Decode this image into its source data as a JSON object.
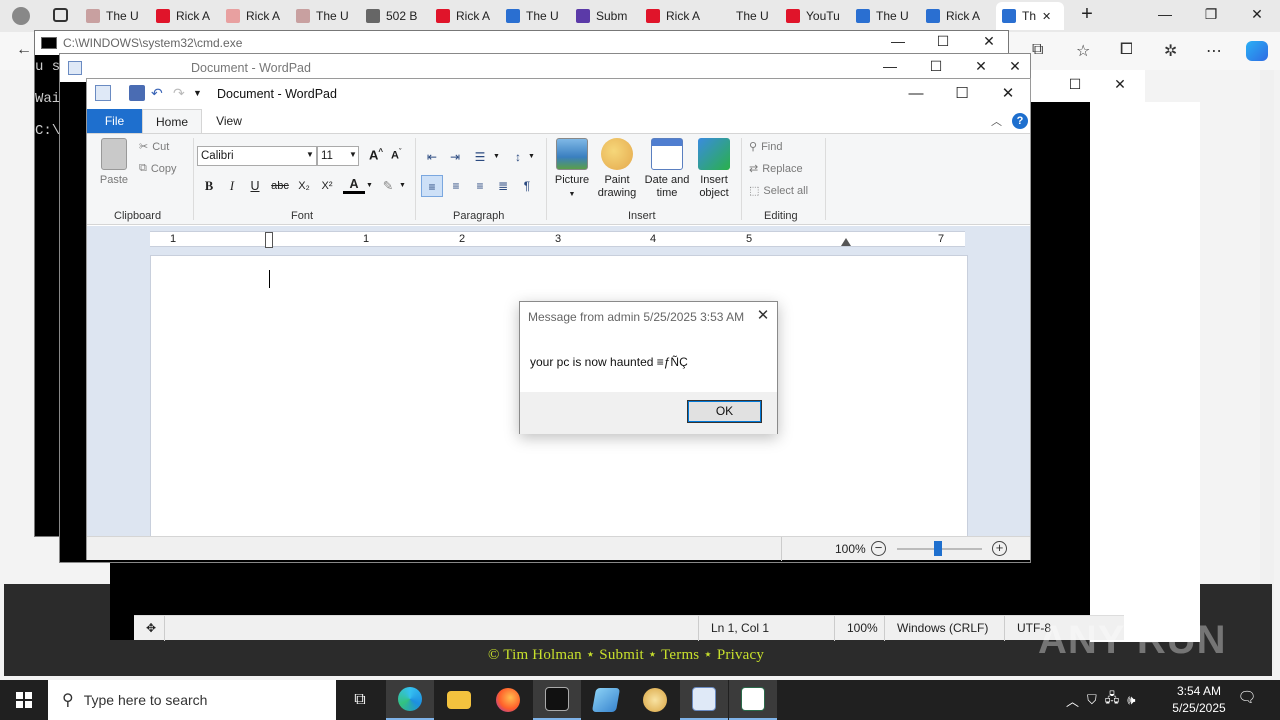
{
  "browser": {
    "tabs": [
      {
        "label": "The U",
        "color": "#c8a0a0"
      },
      {
        "label": "Rick A",
        "color": "#e0142a"
      },
      {
        "label": "Rick A",
        "color": "#e8a0a0"
      },
      {
        "label": "The U",
        "color": "#c8a0a0"
      },
      {
        "label": "502 B",
        "color": "#666666"
      },
      {
        "label": "Rick A",
        "color": "#e0142a"
      },
      {
        "label": "The U",
        "color": "#2a6fd1"
      },
      {
        "label": "Subm",
        "color": "#5b3aa8"
      },
      {
        "label": "Rick A",
        "color": "#e0142a"
      },
      {
        "label": "The U",
        "color": "#e9e9e9"
      },
      {
        "label": "YouTu",
        "color": "#e0142a"
      },
      {
        "label": "The U",
        "color": "#2a6fd1"
      },
      {
        "label": "Rick A",
        "color": "#2a6fd1"
      },
      {
        "label": "Th",
        "color": "#2a6fd1"
      }
    ],
    "footer_links": "© Tim Holman ⋆ Submit ⋆ Terms ⋆ Privacy"
  },
  "cmd": {
    "title": "C:\\WINDOWS\\system32\\cmd.exe",
    "lines": [
      "u s",
      "Wai",
      "C:\\"
    ]
  },
  "wordpad_back": {
    "title": "Document - WordPad"
  },
  "wordpad": {
    "title": "Document - WordPad",
    "tabs": {
      "file": "File",
      "home": "Home",
      "view": "View"
    },
    "clipboard": {
      "paste": "Paste",
      "cut": "Cut",
      "copy": "Copy",
      "label": "Clipboard"
    },
    "font": {
      "family": "Calibri",
      "size": "11",
      "label": "Font"
    },
    "paragraph": {
      "label": "Paragraph"
    },
    "insert": {
      "picture": "Picture",
      "paint_1": "Paint",
      "paint_2": "drawing",
      "datetime_1": "Date and",
      "datetime_2": "time",
      "object_1": "Insert",
      "object_2": "object",
      "label": "Insert"
    },
    "editing": {
      "find": "Find",
      "replace": "Replace",
      "select_all": "Select all",
      "label": "Editing"
    },
    "ruler_numbers": [
      "1",
      "1",
      "2",
      "3",
      "4",
      "5",
      "7"
    ],
    "zoom": "100%"
  },
  "notepad": {
    "status": {
      "position": "Ln 1, Col 1",
      "zoom": "100%",
      "line_ending": "Windows (CRLF)",
      "encoding": "UTF-8"
    }
  },
  "dialog": {
    "title": "Message from admin 5/25/2025 3:53 AM",
    "text": "your pc is now haunted ≡ƒÑÇ",
    "ok": "OK"
  },
  "taskbar": {
    "search_placeholder": "Type here to search",
    "time": "3:54 AM",
    "date": "5/25/2025"
  },
  "watermark": "ANY RUN",
  "colors": {
    "accent": "#1e6fce",
    "taskbar": "#202020",
    "footer_text": "#c8e02c"
  }
}
